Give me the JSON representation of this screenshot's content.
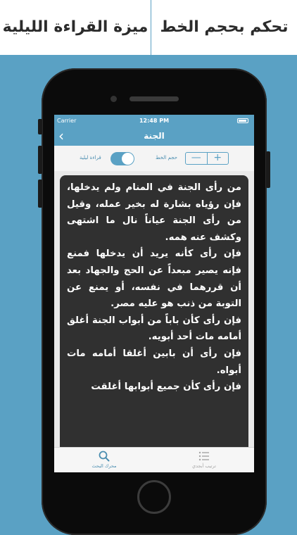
{
  "banner": {
    "left_text": "ميزة القراءة الليلية",
    "right_text": "تحكم بحجم الخط"
  },
  "status_bar": {
    "carrier": "Carrier",
    "time": "12:48 PM"
  },
  "nav": {
    "title": "الجنة",
    "back_icon": "chevron-left-icon"
  },
  "controls": {
    "night_reading_label": "قراءة ليلية",
    "night_reading_on": true,
    "font_size_label": "حجم الخط",
    "decrease_label": "—",
    "increase_label": "+"
  },
  "reader": {
    "paragraphs": [
      "من رأى الجنة في المنام ولم يدخلها، فإن رؤياه بشارة له بخير عمله، وقيل من رأى الجنة عياناً نال ما اشتهى وكشف عنه همه.",
      "فإن رأى كأنه يريد أن يدخلها فمنع فإنه يصير مبعداً عن الحج والجهاد بعد أن قررهما في نفسه، أو يمنع عن التوبة من ذنب هو عليه مصر.",
      "فإن رأى كأن باباً من أبواب الجنة أغلق أمامه مات أحد أبويه.",
      "فإن رأى  أن بابين أغلقا أمامه مات أبواه.",
      "فإن رأى كأن جميع أبوابها أغلقت"
    ]
  },
  "tabbar": {
    "search_label": "محرك البحث",
    "sort_label": "ترتيب أبجدي"
  },
  "colors": {
    "accent": "#5aa1c4",
    "reader_bg": "#303030"
  }
}
